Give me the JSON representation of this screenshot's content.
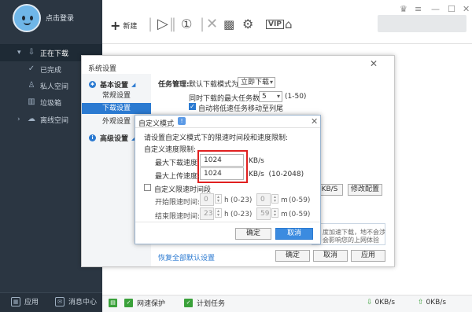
{
  "sidebar": {
    "login": "点击登录",
    "items": [
      {
        "label": "正在下载",
        "icon": "download-icon"
      },
      {
        "label": "已完成",
        "icon": "check-icon"
      },
      {
        "label": "私人空间",
        "icon": "user-icon"
      },
      {
        "label": "垃圾箱",
        "icon": "trash-icon"
      },
      {
        "label": "离线空间",
        "icon": "cloud-icon"
      }
    ],
    "bottom": {
      "apps": "应用",
      "messages": "消息中心"
    }
  },
  "toolbar": {
    "new_label": "新建",
    "vip": "VIP"
  },
  "statusbar": {
    "network_protect": "网速保护",
    "scheduled": "计划任务",
    "down_speed": "0KB/s",
    "up_speed": "0KB/s"
  },
  "settings": {
    "title": "系统设置",
    "categories": [
      "基本设置",
      "高级设置"
    ],
    "subitems": [
      "常规设置",
      "下载设置",
      "外观设置"
    ],
    "task_mgmt_label": "任务管理:",
    "default_mode_label": "默认下载模式为",
    "default_mode_value": "立即下载",
    "max_tasks_label": "同时下载的最大任务数",
    "max_tasks_value": "5",
    "max_tasks_range": "(1-50)",
    "auto_move_label": "自动将低速任务移动至列尾",
    "kbs_btn": "KB/S",
    "modify_btn": "修改配置",
    "hint_text_1": "度加速下载，地不会涉",
    "hint_text_2": "会影响您的上网体验",
    "restore_link": "恢复全部默认设置",
    "ok": "确定",
    "cancel": "取消",
    "apply": "应用"
  },
  "custom_dialog": {
    "title": "自定义模式",
    "badge": "!",
    "desc": "请设置自定义模式下的限速时间段和速度限制:",
    "speed_limit_label": "自定义速度限制:",
    "max_down_label": "最大下载速度:",
    "max_down_value": "1024",
    "max_down_unit": "KB/s",
    "max_up_label": "最大上传速度:",
    "max_up_value": "1024",
    "max_up_unit": "KB/s  (10-2048)",
    "time_limit_label": "自定义限速时间段",
    "start_label": "开始限速时间:",
    "start_h": "0",
    "start_m": "0",
    "end_label": "结束限速时间:",
    "end_h": "23",
    "end_m": "59",
    "h_unit": "h",
    "h_range": "(0-23)",
    "m_unit": "m",
    "m_range": "(0-59)",
    "ok": "确定",
    "cancel": "取消"
  }
}
